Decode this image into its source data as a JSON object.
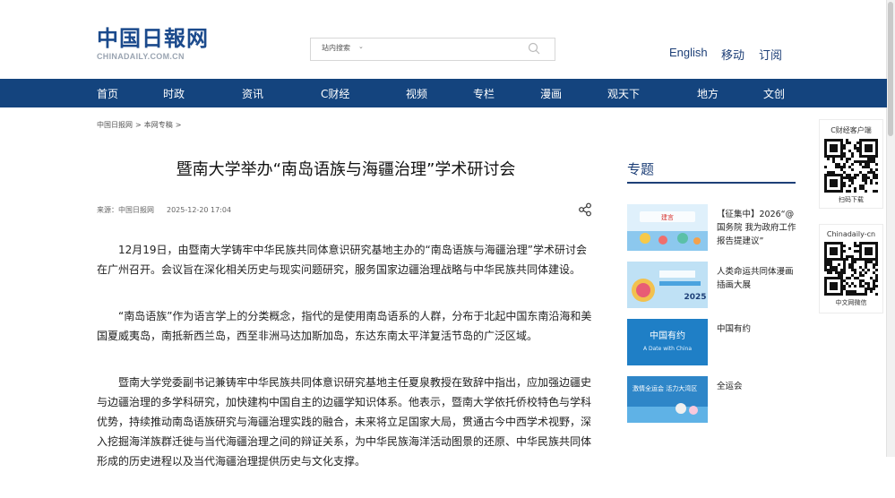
{
  "header": {
    "logo_cn": "中国日報网",
    "logo_en": "CHINADAILY.COM.CN",
    "search_scope": "站内搜索",
    "search_placeholder": "",
    "links": [
      "English",
      "移动",
      "订阅"
    ]
  },
  "nav": [
    "首页",
    "时政",
    "资讯",
    "C财经",
    "视频",
    "专栏",
    "漫画",
    "观天下",
    "地方",
    "文创"
  ],
  "breadcrumb": [
    "中国日报网",
    ">",
    "本网专稿",
    ">"
  ],
  "article": {
    "title": "暨南大学举办“南岛语族与海疆治理”学术研讨会",
    "source": "来源：中国日报网",
    "date": "2025-12-20 17:04",
    "paragraphs": [
      "12月19日，由暨南大学铸牢中华民族共同体意识研究基地主办的“南岛语族与海疆治理”学术研讨会在广州召开。会议旨在深化相关历史与现实问题研究，服务国家边疆治理战略与中华民族共同体建设。",
      "“南岛语族”作为语言学上的分类概念，指代的是使用南岛语系的人群，分布于北起中国东南沿海和美国夏威夷岛，南抵新西兰岛，西至非洲马达加斯加岛，东达东南太平洋复活节岛的广泛区域。",
      "暨南大学党委副书记兼铸牢中华民族共同体意识研究基地主任夏泉教授在致辞中指出，应加强边疆史与边疆治理的多学科研究，加快建构中国自主的边疆学知识体系。他表示，暨南大学依托侨校特色与学科优势，持续推动南岛语族研究与海疆治理实践的融合，未来将立足国家大局，贯通古今中西学术视野，深入挖掘海洋族群迁徙与当代海疆治理之间的辩证关系，为中华民族海洋活动图景的还原、中华民族共同体形成的历史进程以及当代海疆治理提供历史与文化支撑。"
    ]
  },
  "sidebar": {
    "heading": "专题",
    "items": [
      {
        "label": "【征集中】2026“@国务院 我为政府工作报告提建议”",
        "thumb_text": "建言",
        "color": "#3a8fd3"
      },
      {
        "label": "人类命运共同体漫画插画大展",
        "thumb_text": "2025",
        "color": "#6ab1e0"
      },
      {
        "label": "中国有约",
        "thumb_text": "中国有约",
        "thumb_sub": "A Date with China",
        "color": "#1f7fc6"
      },
      {
        "label": "全运会",
        "thumb_text": "激情全运会 活力大湾区",
        "color": "#2e86c8"
      }
    ]
  },
  "qr": [
    {
      "label": "C财经客户端",
      "caption": "扫码下载"
    },
    {
      "label": "Chinadaily-cn",
      "caption": "中文网微信"
    }
  ],
  "colors": {
    "nav_bg": "#14447e",
    "accent": "#1d3f77"
  }
}
